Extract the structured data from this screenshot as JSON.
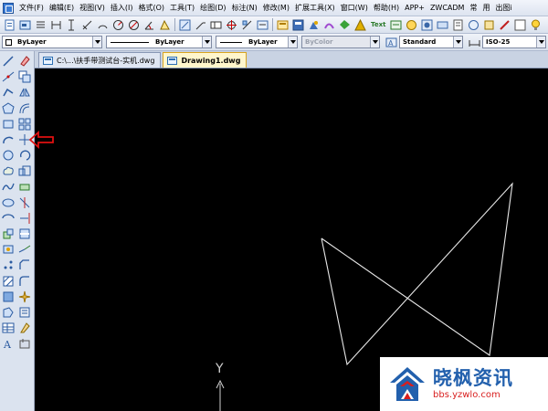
{
  "menubar": {
    "items": [
      "文件(F)",
      "编辑(E)",
      "视图(V)",
      "插入(I)",
      "格式(O)",
      "工具(T)",
      "绘图(D)",
      "标注(N)",
      "修改(M)",
      "扩展工具(X)",
      "窗口(W)",
      "帮助(H)",
      "APP+",
      "ZWCADM",
      "常",
      "用",
      "出图i"
    ]
  },
  "toolbar": {
    "text_button": "Text"
  },
  "properties": {
    "layer": "ByLayer",
    "linetype": "ByLayer",
    "lineweight": "ByLayer",
    "color": "ByColor",
    "text_style": "Standard",
    "dim_style": "ISO-25"
  },
  "tabs": [
    {
      "label": "C:\\...\\扶手带测试台-实机.dwg",
      "active": false
    },
    {
      "label": "Drawing1.dwg",
      "active": true
    }
  ],
  "canvas": {
    "background": "#000000",
    "ucs_y_label": "Y",
    "drawing_color": "#e8e8e8"
  },
  "annotation": {
    "arrow_color": "#e01010",
    "description": "red outline arrow pointing at a left toolbar tool"
  },
  "watermark": {
    "title": "晓枫资讯",
    "url": "bbs.yzwlo.com",
    "title_color": "#2260ad",
    "url_color": "#d81e1e"
  },
  "left_toolbar": {
    "column1": [
      "line-icon",
      "construction-line-icon",
      "polyline-icon",
      "polygon-icon",
      "rectangle-icon",
      "arc-icon",
      "circle-icon",
      "revision-cloud-icon",
      "spline-icon",
      "ellipse-icon",
      "ellipse-arc-icon",
      "insert-block-icon",
      "make-block-icon",
      "point-icon",
      "hatch-icon",
      "gradient-icon",
      "region-icon",
      "table-icon",
      "mtext-icon"
    ],
    "column2": [
      "erase-icon",
      "copy-icon",
      "mirror-icon",
      "offset-icon",
      "array-icon",
      "move-icon",
      "rotate-icon",
      "scale-icon",
      "stretch-icon",
      "trim-icon",
      "extend-icon",
      "break-icon",
      "join-icon",
      "chamfer-icon",
      "fillet-icon",
      "explode-icon",
      "properties-icon",
      "match-icon",
      "clean-icon"
    ]
  }
}
